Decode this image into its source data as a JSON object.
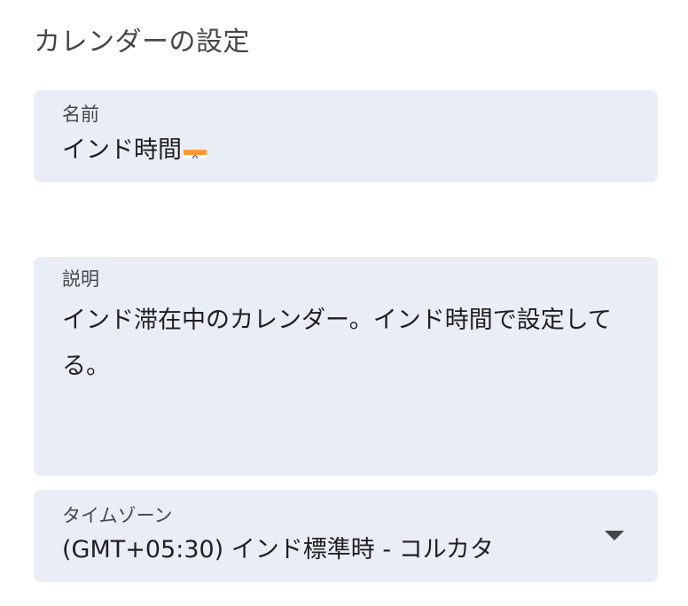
{
  "page": {
    "title": "カレンダーの設定"
  },
  "name_field": {
    "label": "名前",
    "value": "インド時間",
    "flag_icon": "india-flag-icon"
  },
  "description_field": {
    "label": "説明",
    "value": "インド滞在中のカレンダー。インド時間で設定してる。"
  },
  "timezone_field": {
    "label": "タイムゾーン",
    "value": "(GMT+05:30) インド標準時 - コルカタ",
    "dropdown_icon": "caret-down-icon"
  },
  "colors": {
    "field_background": "#e9eef6",
    "label_text": "#444746",
    "value_text": "#1f1f1f"
  }
}
